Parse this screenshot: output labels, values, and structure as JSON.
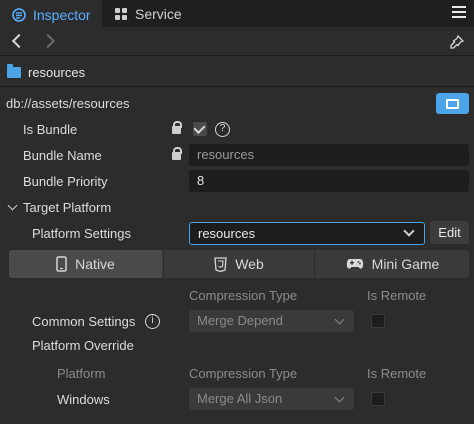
{
  "tabs": {
    "inspector": "Inspector",
    "service": "Service"
  },
  "header": {
    "title": "resources"
  },
  "asset": {
    "path": "db://assets/resources"
  },
  "fields": {
    "is_bundle": "Is Bundle",
    "bundle_name": "Bundle Name",
    "bundle_name_value": "resources",
    "bundle_priority": "Bundle Priority",
    "bundle_priority_value": "8",
    "target_platform": "Target Platform",
    "platform_settings": "Platform Settings",
    "platform_settings_value": "resources",
    "edit": "Edit"
  },
  "platform_tabs": {
    "native": "Native",
    "web": "Web",
    "minigame": "Mini Game"
  },
  "settings": {
    "compression_type_header": "Compression Type",
    "is_remote_header": "Is Remote",
    "common_settings": "Common Settings",
    "common_compression": "Merge Depend",
    "platform_override": "Platform Override",
    "platform_header": "Platform",
    "override_compression_header": "Compression Type",
    "override_remote_header": "Is Remote",
    "windows_label": "Windows",
    "windows_compression": "Merge All Json"
  },
  "colors": {
    "accent": "#4ba4e8",
    "background": "#2c2c2c",
    "tabbar": "#1f1f1f"
  }
}
